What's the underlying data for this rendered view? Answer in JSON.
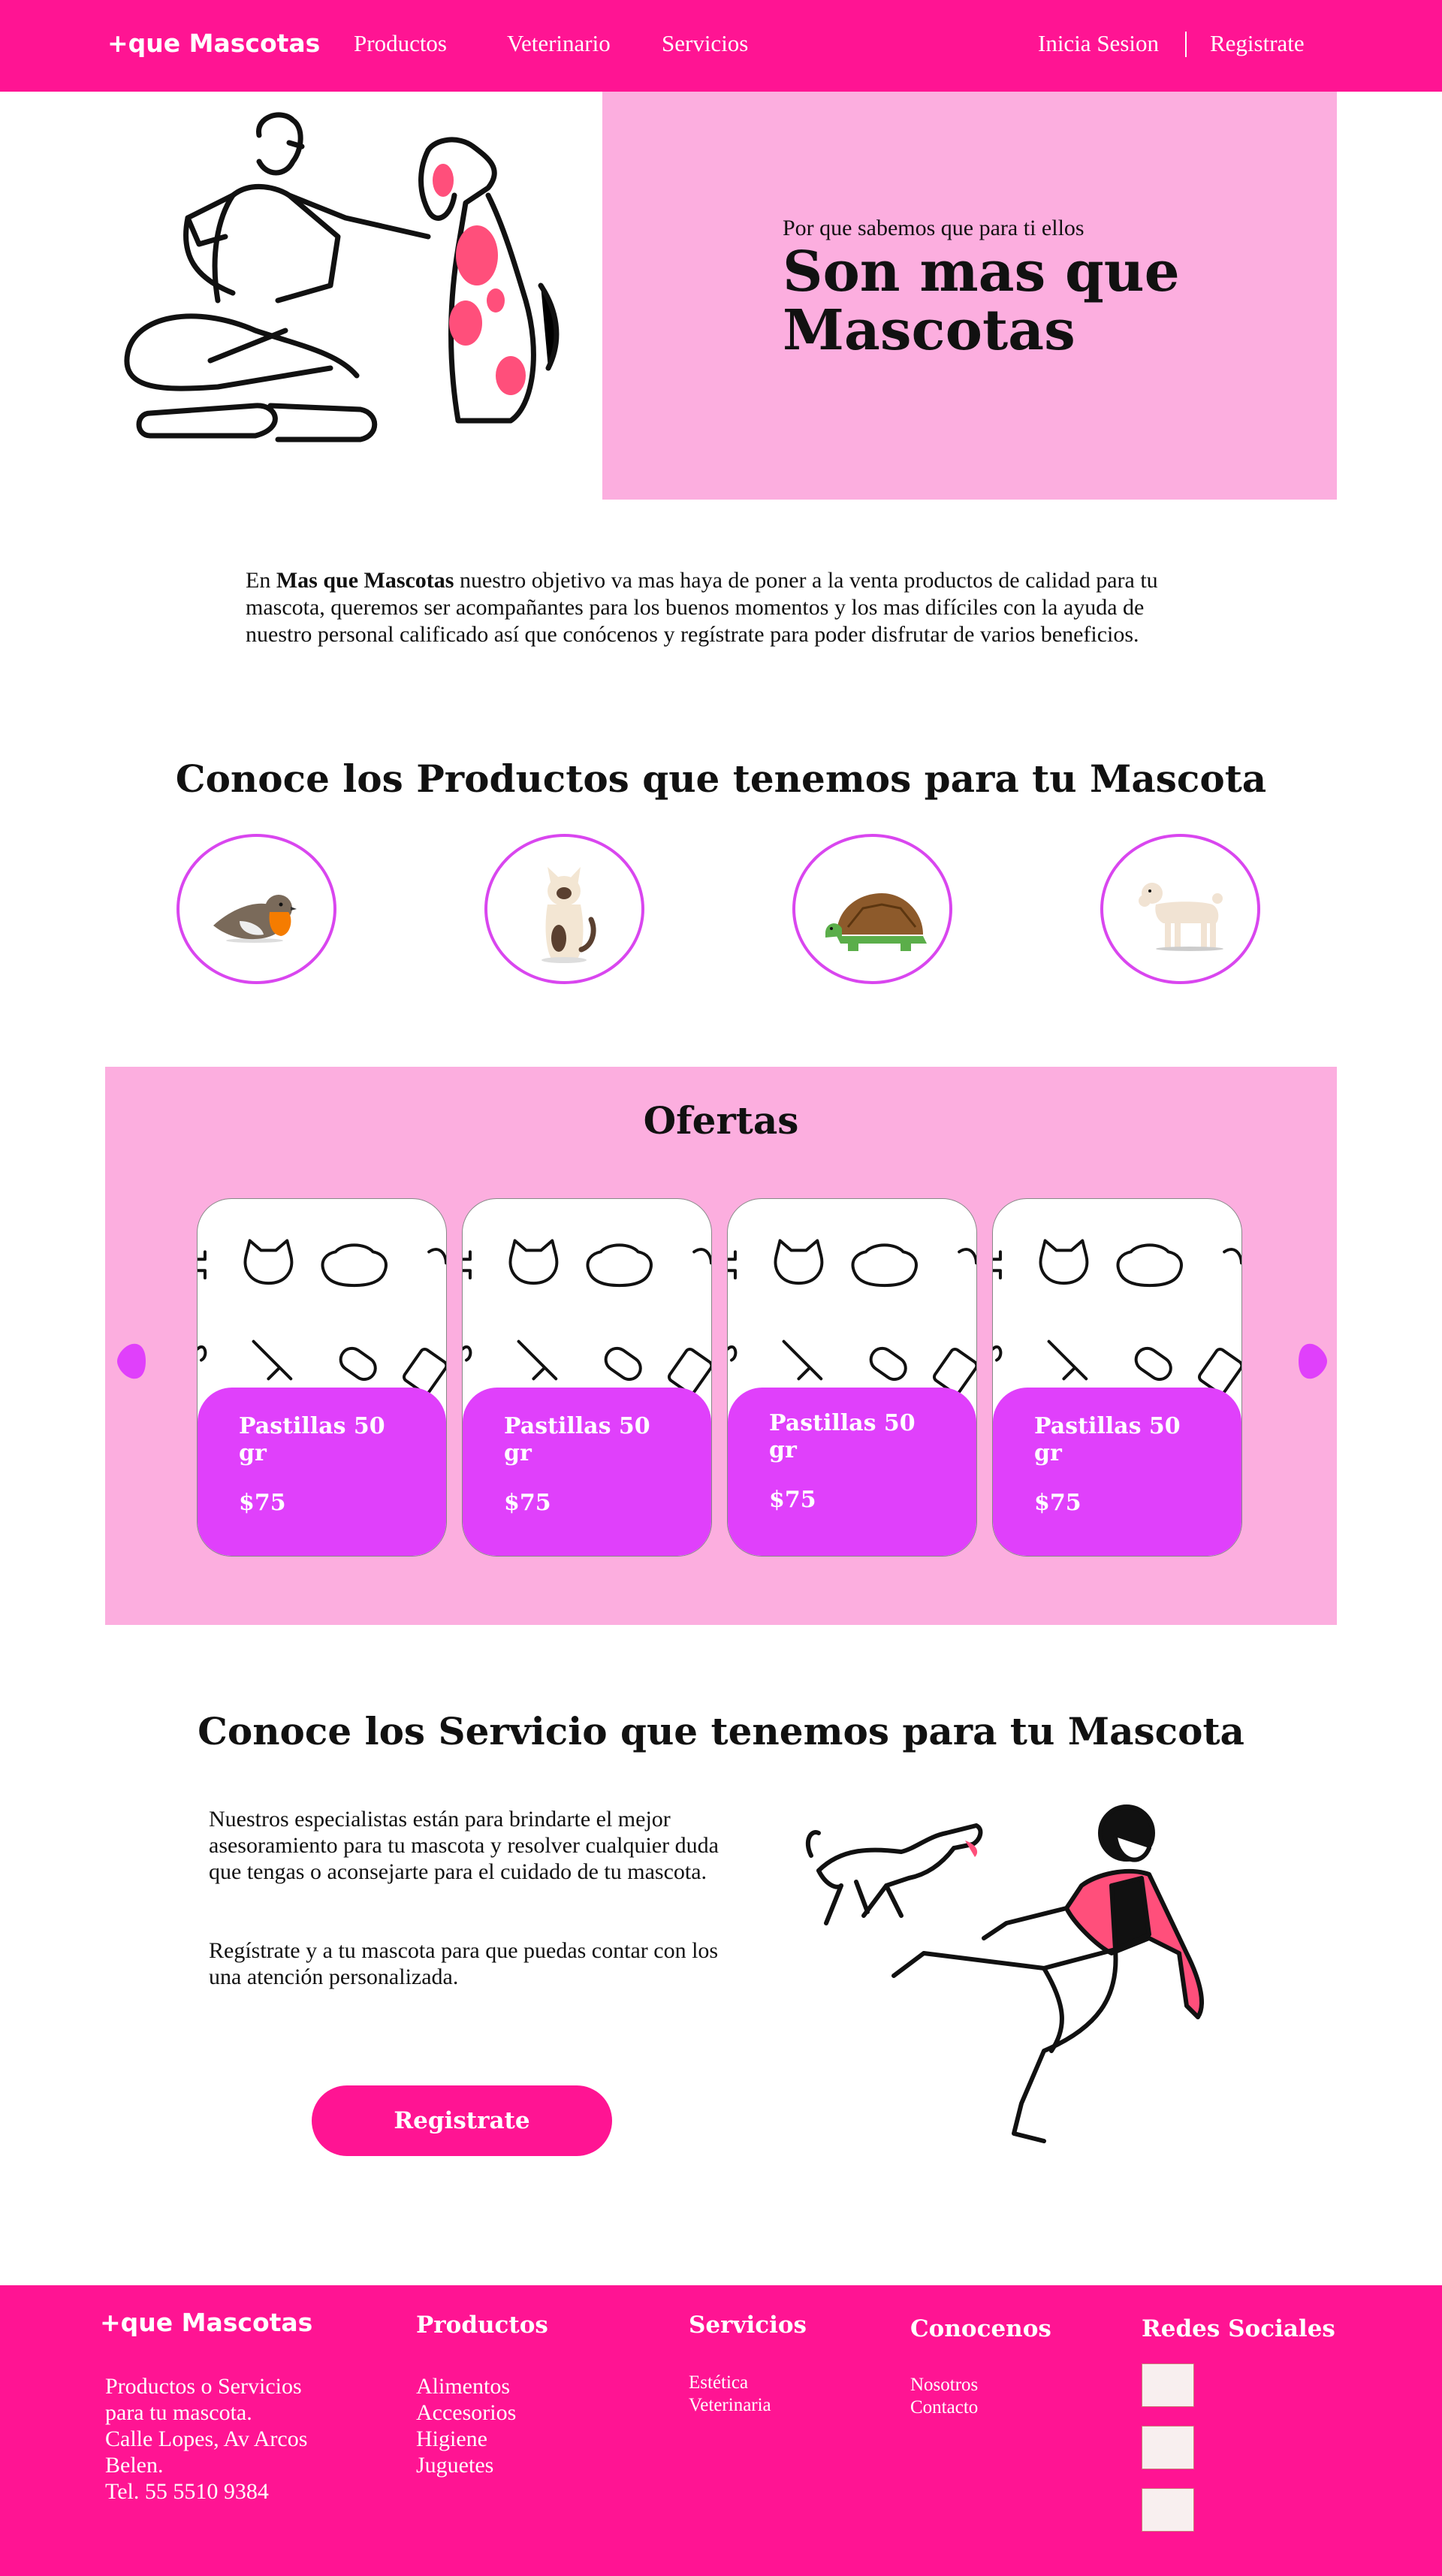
{
  "nav": {
    "brand": "+que Mascotas",
    "links": [
      "Productos",
      "Veterinario",
      "Servicios"
    ],
    "login": "Inicia Sesion",
    "register": "Registrate"
  },
  "hero": {
    "subtitle": "Por que sabemos que para ti ellos",
    "title": "Son mas que Mascotas"
  },
  "intro": {
    "prefix": "En ",
    "bold": "Mas que Mascotas",
    "text": " nuestro objetivo va mas haya de poner a la venta productos de calidad para tu mascota, queremos ser acompañantes para los buenos momentos y los mas difíciles con la ayuda de nuestro personal calificado así que conócenos y regístrate para poder disfrutar de varios beneficios."
  },
  "products": {
    "title": "Conoce los Productos que tenemos para tu Mascota",
    "categories": [
      {
        "icon": "bird-icon"
      },
      {
        "icon": "cat-icon"
      },
      {
        "icon": "turtle-icon"
      },
      {
        "icon": "dog-icon"
      }
    ]
  },
  "ofertas": {
    "title": "Ofertas",
    "cards": [
      {
        "name": "Pastillas 50 gr",
        "price": "$75"
      },
      {
        "name": "Pastillas 50 gr",
        "price": "$75"
      },
      {
        "name": "Pastillas 50 gr",
        "price": "$75"
      },
      {
        "name": "Pastillas 50 gr",
        "price": "$75"
      }
    ]
  },
  "services": {
    "title": "Conoce los Servicio que tenemos para tu Mascota",
    "p1": "Nuestros especialistas están para brindarte el mejor asesoramiento para tu mascota y resolver cualquier duda que tengas o aconsejarte para el cuidado de tu mascota.",
    "p2": "Regístrate y a tu mascota para que puedas contar con los una atención personalizada.",
    "button": "Registrate"
  },
  "footer": {
    "brand": "+que Mascotas",
    "about": [
      "Productos o Servicios",
      "para tu mascota.",
      "Calle Lopes, Av Arcos",
      "Belen.",
      "Tel. 55 5510 9384"
    ],
    "productos": {
      "title": "Productos",
      "items": [
        "Alimentos",
        "Accesorios",
        "Higiene",
        "Juguetes"
      ]
    },
    "servicios": {
      "title": "Servicios",
      "items": [
        "Estética",
        "Veterinaria"
      ]
    },
    "conocenos": {
      "title": "Conocenos",
      "items": [
        "Nosotros",
        "Contacto"
      ]
    },
    "redes": {
      "title": "Redes Sociales"
    }
  },
  "colors": {
    "primary": "#ff1493",
    "panel": "#fcaedf",
    "accent": "#e040fb",
    "ring": "#d946ef"
  }
}
